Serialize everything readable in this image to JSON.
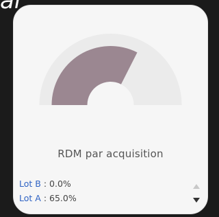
{
  "header_fragment": "al",
  "colors": {
    "background": "#1b1b1b",
    "card": "#f6f6f6",
    "gauge_track": "#ebebeb",
    "gauge_fill": "#9b8791",
    "legend_name": "#2f63c4"
  },
  "chart_data": {
    "type": "pie",
    "title": "RDM par acquisition",
    "series": [
      {
        "name": "Lot B",
        "value": 0.0,
        "label": "0.0%"
      },
      {
        "name": "Lot A",
        "value": 65.0,
        "label": "65.0%"
      }
    ],
    "legend": {
      "placement": "bottom-left",
      "items": [
        {
          "name": "Lot B",
          "separator": ":",
          "value": "0.0%"
        },
        {
          "name": "Lot A",
          "separator": ":",
          "value": "65.0%"
        }
      ]
    }
  },
  "icons": {
    "scroll_up": "caret-up-icon",
    "scroll_down": "caret-down-icon"
  }
}
